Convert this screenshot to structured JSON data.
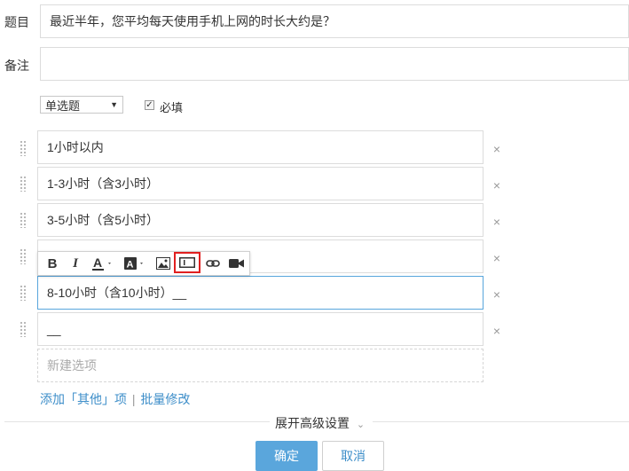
{
  "question": {
    "label": "题目",
    "value": "最近半年，您平均每天使用手机上网的时长大约是？"
  },
  "note": {
    "label": "备注",
    "value": ""
  },
  "type_select": {
    "selected": "单选题"
  },
  "required": {
    "label": "必填",
    "checked": true
  },
  "options": [
    {
      "text": "1小时以内"
    },
    {
      "text": "1-3小时（含3小时）"
    },
    {
      "text": "3-5小时（含5小时）"
    },
    {
      "text": ""
    },
    {
      "text": "8-10小时（含10小时）__"
    },
    {
      "text": "__"
    }
  ],
  "new_option_placeholder": "新建选项",
  "links": {
    "add_other": "添加「其他」项",
    "separator": "|",
    "batch_edit": "批量修改"
  },
  "advanced": {
    "label": "展开高级设置",
    "chevron": "⌄"
  },
  "buttons": {
    "confirm": "确定",
    "cancel": "取消"
  },
  "colors": {
    "accent": "#3d8ec9",
    "confirm_bg": "#5aa6dc",
    "highlight": "#e02020"
  }
}
